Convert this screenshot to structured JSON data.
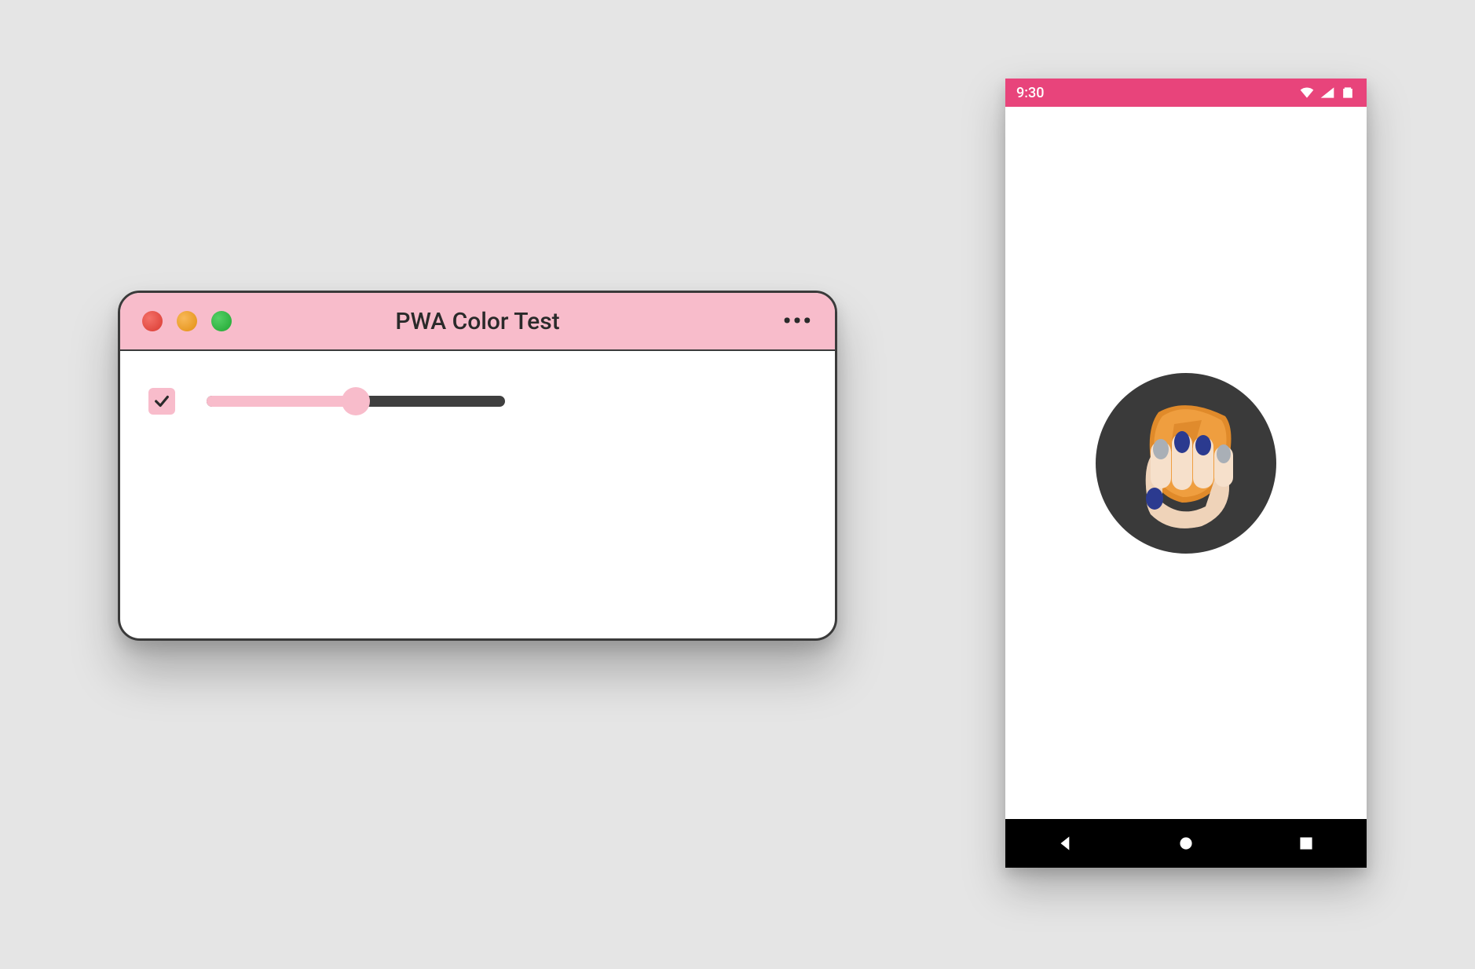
{
  "colors": {
    "canvas": "#e5e5e5",
    "desktop_titlebar": "#f8bccb",
    "accent": "#f8bccb",
    "phone_statusbar": "#e8447b",
    "phone_navbar": "#000000",
    "splash_circle": "#3a3a3a"
  },
  "desktop": {
    "title": "PWA Color Test",
    "menu_glyph": "•••",
    "checkbox_checked": true,
    "slider_value": 50,
    "traffic_lights": {
      "close": "close-icon",
      "minimize": "minimize-icon",
      "maximize": "maximize-icon"
    }
  },
  "phone": {
    "statusbar": {
      "time": "9:30",
      "icons": [
        "wifi-icon",
        "signal-icon",
        "battery-icon"
      ]
    },
    "splash": {
      "icon_name": "squoosh-hand-icon"
    },
    "navbar": {
      "back": "back-icon",
      "home": "home-icon",
      "recents": "recents-icon"
    }
  }
}
